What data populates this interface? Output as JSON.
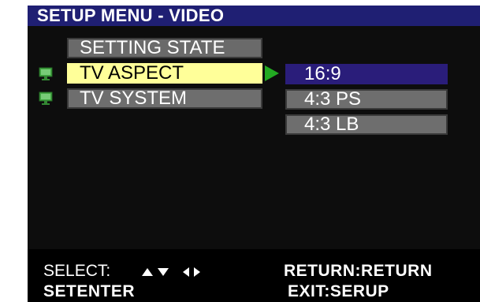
{
  "title": "SETUP MENU - VIDEO",
  "menu": {
    "header": "SETTING STATE",
    "items": [
      {
        "label": "TV ASPECT",
        "icon": "monitor-icon",
        "active": true
      },
      {
        "label": "TV SYSTEM",
        "icon": "monitor-icon",
        "active": false
      }
    ]
  },
  "options": [
    {
      "label": "16:9",
      "selected": true
    },
    {
      "label": "4:3  PS",
      "selected": false
    },
    {
      "label": "4:3  LB",
      "selected": false
    }
  ],
  "footer": {
    "select_label": "SELECT:",
    "nav_icons": [
      "arrow-up-icon",
      "arrow-down-icon",
      "arrow-left-icon",
      "arrow-right-icon"
    ],
    "enter_label": "SETENTER",
    "return_label": "RETURN:RETURN",
    "exit_label": "EXIT:SERUP"
  },
  "colors": {
    "title_bar": "#1f1f73",
    "active_item": "#ffff99",
    "selected_option": "#2a1d7a",
    "item_gray": "#6e6e6e",
    "pointer_green": "#22aa22"
  }
}
